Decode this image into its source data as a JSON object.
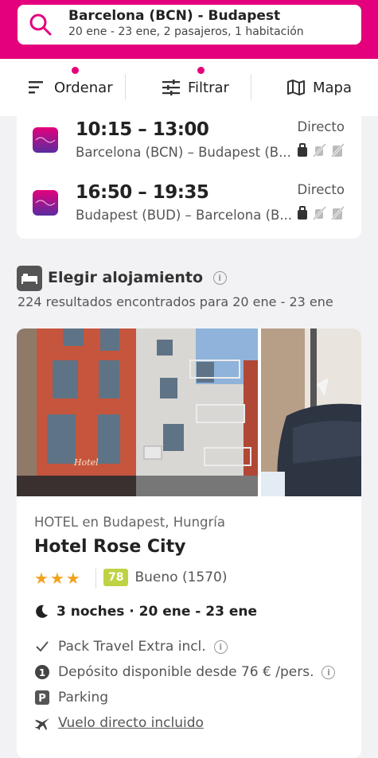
{
  "search": {
    "route": "Barcelona (BCN) - Budapest",
    "details": "20 ene - 23 ene, 2 pasajeros, 1 habitación"
  },
  "toolbar": {
    "sort_label": "Ordenar",
    "filter_label": "Filtrar",
    "map_label": "Mapa",
    "accent": "#e4007c"
  },
  "flights": [
    {
      "time": "10:15 – 13:00",
      "route": "Barcelona (BCN) – Budapest (B...",
      "stops": "Directo"
    },
    {
      "time": "16:50 – 19:35",
      "route": "Budapest (BUD) – Barcelona (B...",
      "stops": "Directo"
    }
  ],
  "accommodation": {
    "title": "Elegir alojamiento",
    "results": "224 resultados encontrados para 20 ene - 23 ene"
  },
  "hotel": {
    "category": "HOTEL en Budapest, Hungría",
    "name": "Hotel Rose City",
    "stars": 3,
    "score": "78",
    "rating_text": "Bueno (1570)",
    "score_color": "#bfd243",
    "nights": "3 noches · 20 ene - 23 ene",
    "features": [
      {
        "icon": "check-icon",
        "label": "Pack Travel Extra incl."
      },
      {
        "icon": "deposit-icon",
        "label": "Depósito disponible desde 76 € /pers."
      },
      {
        "icon": "parking-icon",
        "label": "Parking"
      },
      {
        "icon": "plane-icon",
        "label": "Vuelo directo incluido"
      }
    ]
  }
}
